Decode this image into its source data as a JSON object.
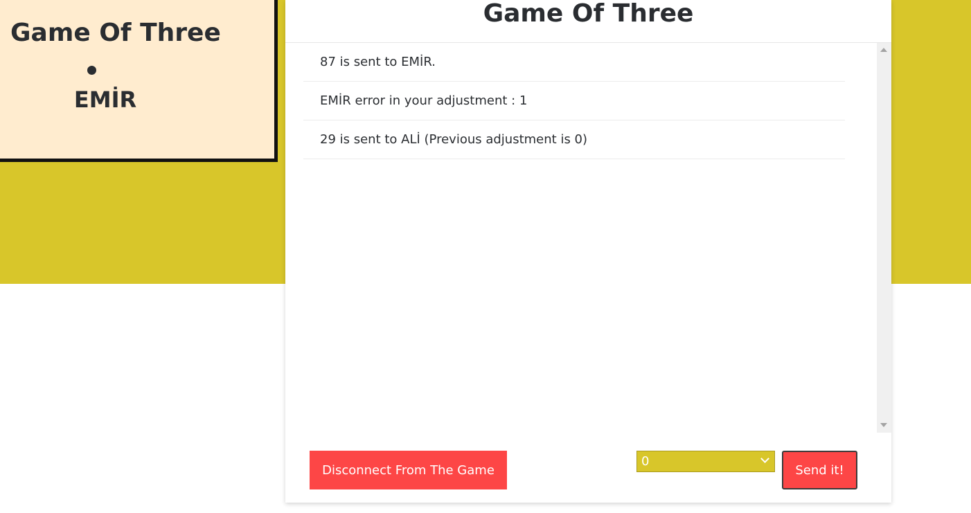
{
  "colors": {
    "band": "#d8c62a",
    "players_panel_bg": "#ffeccf",
    "button_red": "#fd4646",
    "text": "#2a2d31"
  },
  "players_panel": {
    "title": "Game Of Three",
    "players": [
      {
        "name": "EMİR"
      }
    ]
  },
  "game": {
    "title": "Game Of Three",
    "log": [
      "87 is sent to EMİR.",
      "EMİR error in your adjustment : 1",
      "29 is sent to ALİ (Previous adjustment is 0)"
    ]
  },
  "controls": {
    "disconnect_label": "Disconnect From The Game",
    "adjustment_selected": "0",
    "send_label": "Send it!"
  }
}
